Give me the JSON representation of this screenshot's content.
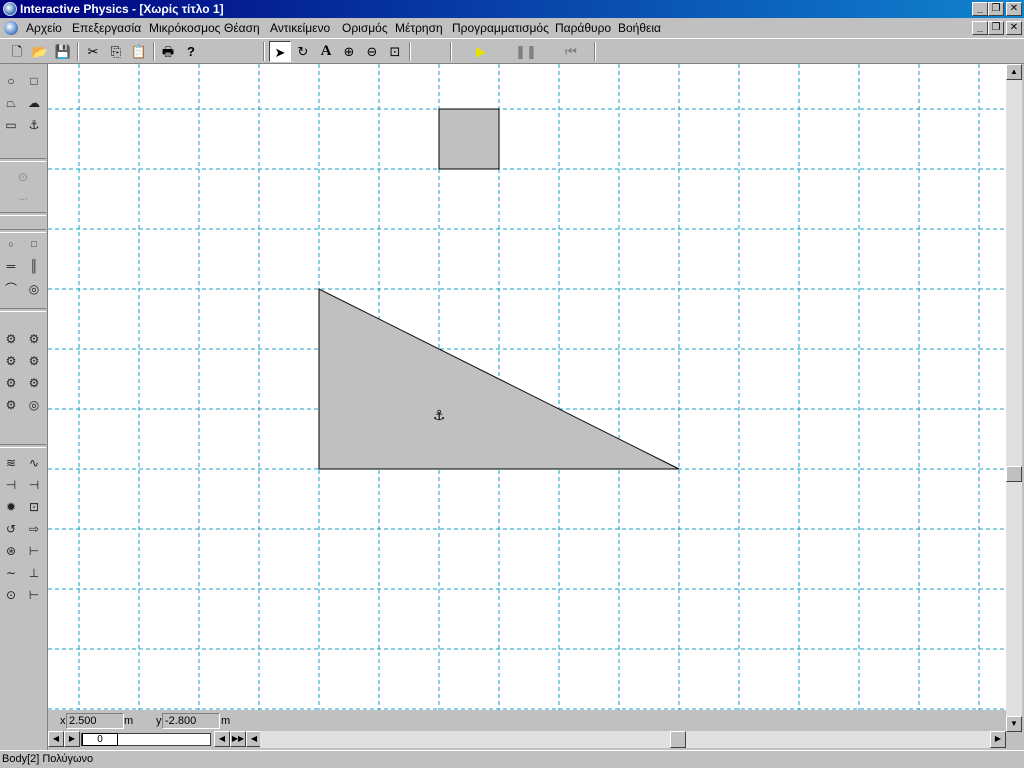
{
  "window": {
    "title": "Interactive Physics - [Χωρίς τίτλο 1]"
  },
  "menu": {
    "items": [
      "Αρχείο",
      "Επεξεργασία",
      "Μικρόκοσμος",
      "Θέαση",
      "Αντικείμενο",
      "Ορισμός",
      "Μέτρηση",
      "Προγραμματισμός",
      "Παράθυρο",
      "Βοήθεια"
    ]
  },
  "toolbar": {
    "icons": [
      "new-icon",
      "open-icon",
      "save-icon",
      "cut-icon",
      "copy-icon",
      "paste-icon",
      "print-icon",
      "help-icon",
      "arrow-icon",
      "rotate-icon",
      "text-icon",
      "zoom-in-icon",
      "zoom-out-icon",
      "zoom-fit-icon",
      "run-icon",
      "pause-icon",
      "reset-icon"
    ],
    "text_tool_label": "A"
  },
  "canvas": {
    "grid_color": "#1aa0c8",
    "body_fill": "#c0c0c0",
    "anchor_symbol": "⚓"
  },
  "coords": {
    "x_label": "x",
    "x_value": "2.500",
    "x_unit": "m",
    "y_label": "y",
    "y_value": "-2.800",
    "y_unit": "m"
  },
  "frame": {
    "value": "0"
  },
  "status": {
    "text": "Body[2] Πολύγωνο"
  }
}
